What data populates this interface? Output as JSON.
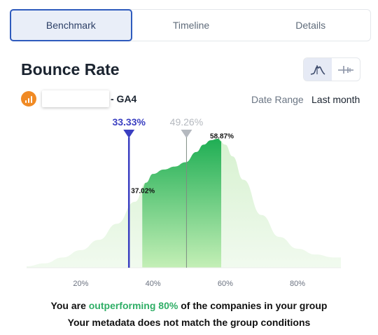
{
  "tabs": [
    {
      "label": "Benchmark",
      "active": true
    },
    {
      "label": "Timeline",
      "active": false
    },
    {
      "label": "Details",
      "active": false
    }
  ],
  "header": {
    "title": "Bounce Rate",
    "view_toggles": [
      {
        "icon": "distribution-curve-icon",
        "active": true
      },
      {
        "icon": "range-slider-icon",
        "active": false
      }
    ]
  },
  "source": {
    "icon": "google-analytics-icon",
    "suffix": "- GA4"
  },
  "date_range": {
    "label": "Date Range",
    "value": "Last month"
  },
  "colors": {
    "accent_blue": "#3a3fc1",
    "marker_gray": "#b5b9bf",
    "curve_light": "#e6f6e3",
    "fill_dark": "#23b45a",
    "fill_light": "#b9ecb0",
    "outperform_green": "#2fae66",
    "tab_border": "#2f5bbd"
  },
  "chart_data": {
    "type": "area",
    "x": [
      5,
      10,
      15,
      20,
      25,
      30,
      35,
      38,
      40,
      43,
      46,
      49,
      52,
      54,
      56,
      58,
      60,
      62,
      65,
      70,
      75,
      80,
      85,
      90,
      92
    ],
    "y": [
      1,
      3,
      7,
      12,
      19,
      30,
      45,
      58,
      64,
      67,
      69,
      72,
      79,
      84,
      87,
      88,
      84,
      76,
      60,
      36,
      21,
      13,
      9,
      7,
      7
    ],
    "xlim": [
      5,
      92
    ],
    "x_ticks": [
      20,
      40,
      60,
      80
    ],
    "x_tick_labels": [
      "20%",
      "40%",
      "60%",
      "80%"
    ],
    "highlight_range": [
      37.02,
      58.87
    ],
    "highlight_labels": [
      "37.02%",
      "58.87%"
    ],
    "markers": [
      {
        "value": 33.33,
        "label": "33.33%",
        "role": "yours"
      },
      {
        "value": 49.26,
        "label": "49.26%",
        "role": "median"
      }
    ]
  },
  "footer": {
    "line1_before": "You are ",
    "line1_highlight": "outperforming 80%",
    "line1_after": " of the companies in your group",
    "line2": "Your metadata does not match the group conditions"
  }
}
